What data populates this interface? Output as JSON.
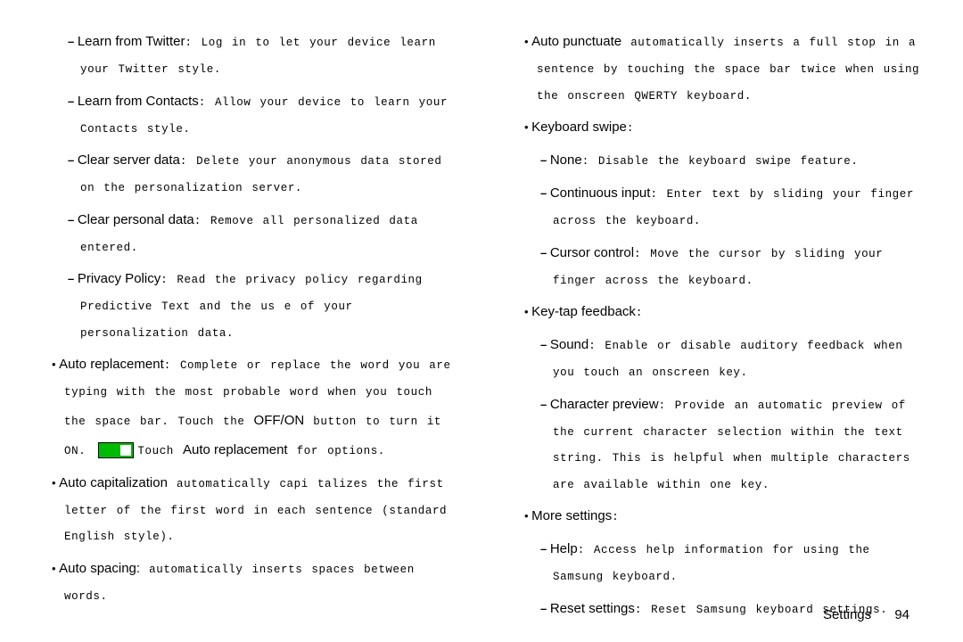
{
  "left": {
    "learnTwitter": {
      "term": "Learn from Twitter",
      "desc": ": Log in to let your device learn your Twitter style."
    },
    "learnContacts": {
      "term": "Learn from Contacts",
      "desc": ": Allow your device to learn your Contacts style."
    },
    "clearServer": {
      "term": "Clear server data",
      "desc": ": Delete your anonymous data stored on the personalization server."
    },
    "clearPersonal": {
      "term": "Clear personal data",
      "desc": ": Remove all personalized data entered."
    },
    "privacy": {
      "term": "Privacy Policy",
      "desc": ": Read the privacy policy regarding Predictive Text and the us     e of your personalization data."
    },
    "autoReplace": {
      "term": "Auto replacement",
      "desc1": ": Complete or replace the word you are typing with the most probable word when you touch the space bar. Touch the ",
      "offon": "OFF/ON",
      "desc2": " button to turn it ON. ",
      "desc3": "Touch ",
      "term2": "Auto replacement",
      "desc4": " for options."
    },
    "autoCap": {
      "term": "Auto capitalization",
      "desc": " automatically capi    talizes the first letter of the first word in each sentence (standard English style)."
    },
    "autoSpace": {
      "term": "Auto spacing:",
      "desc": " automatically inserts spaces between words."
    }
  },
  "right": {
    "autoPunct": {
      "term": "Auto punctuate",
      "desc": " automatically inserts a full stop in a sentence by touching the space bar twice when using the onscreen QWERTY keyboard."
    },
    "kbSwipe": {
      "term": "Keyboard swipe",
      "desc": ":"
    },
    "none": {
      "term": "None",
      "desc": ": Disable the keyboard swipe feature."
    },
    "contInput": {
      "term": "Continuous input",
      "desc": ": Enter text by sliding your finger across the keyboard."
    },
    "cursor": {
      "term": "Cursor control",
      "desc": ": Move the cursor by sliding your finger across the keyboard."
    },
    "keytap": {
      "term": "Key-tap feedback",
      "desc": ":"
    },
    "sound": {
      "term": "Sound",
      "desc": ": Enable or disable auditory feedback when you touch an onscreen key."
    },
    "charPrev": {
      "term": "Character preview",
      "desc": ": Provide an automatic preview of the current character selection within the text string. This is helpful when multiple characters are available within one key."
    },
    "more": {
      "term": "More settings",
      "desc": ":"
    },
    "help": {
      "term": "Help",
      "desc": ": Access help information for using the Samsung keyboard."
    },
    "reset": {
      "term": "Reset settings",
      "desc": ": Reset Samsung keyboard settings."
    }
  },
  "footer": {
    "label": "Settings",
    "page": "94"
  }
}
